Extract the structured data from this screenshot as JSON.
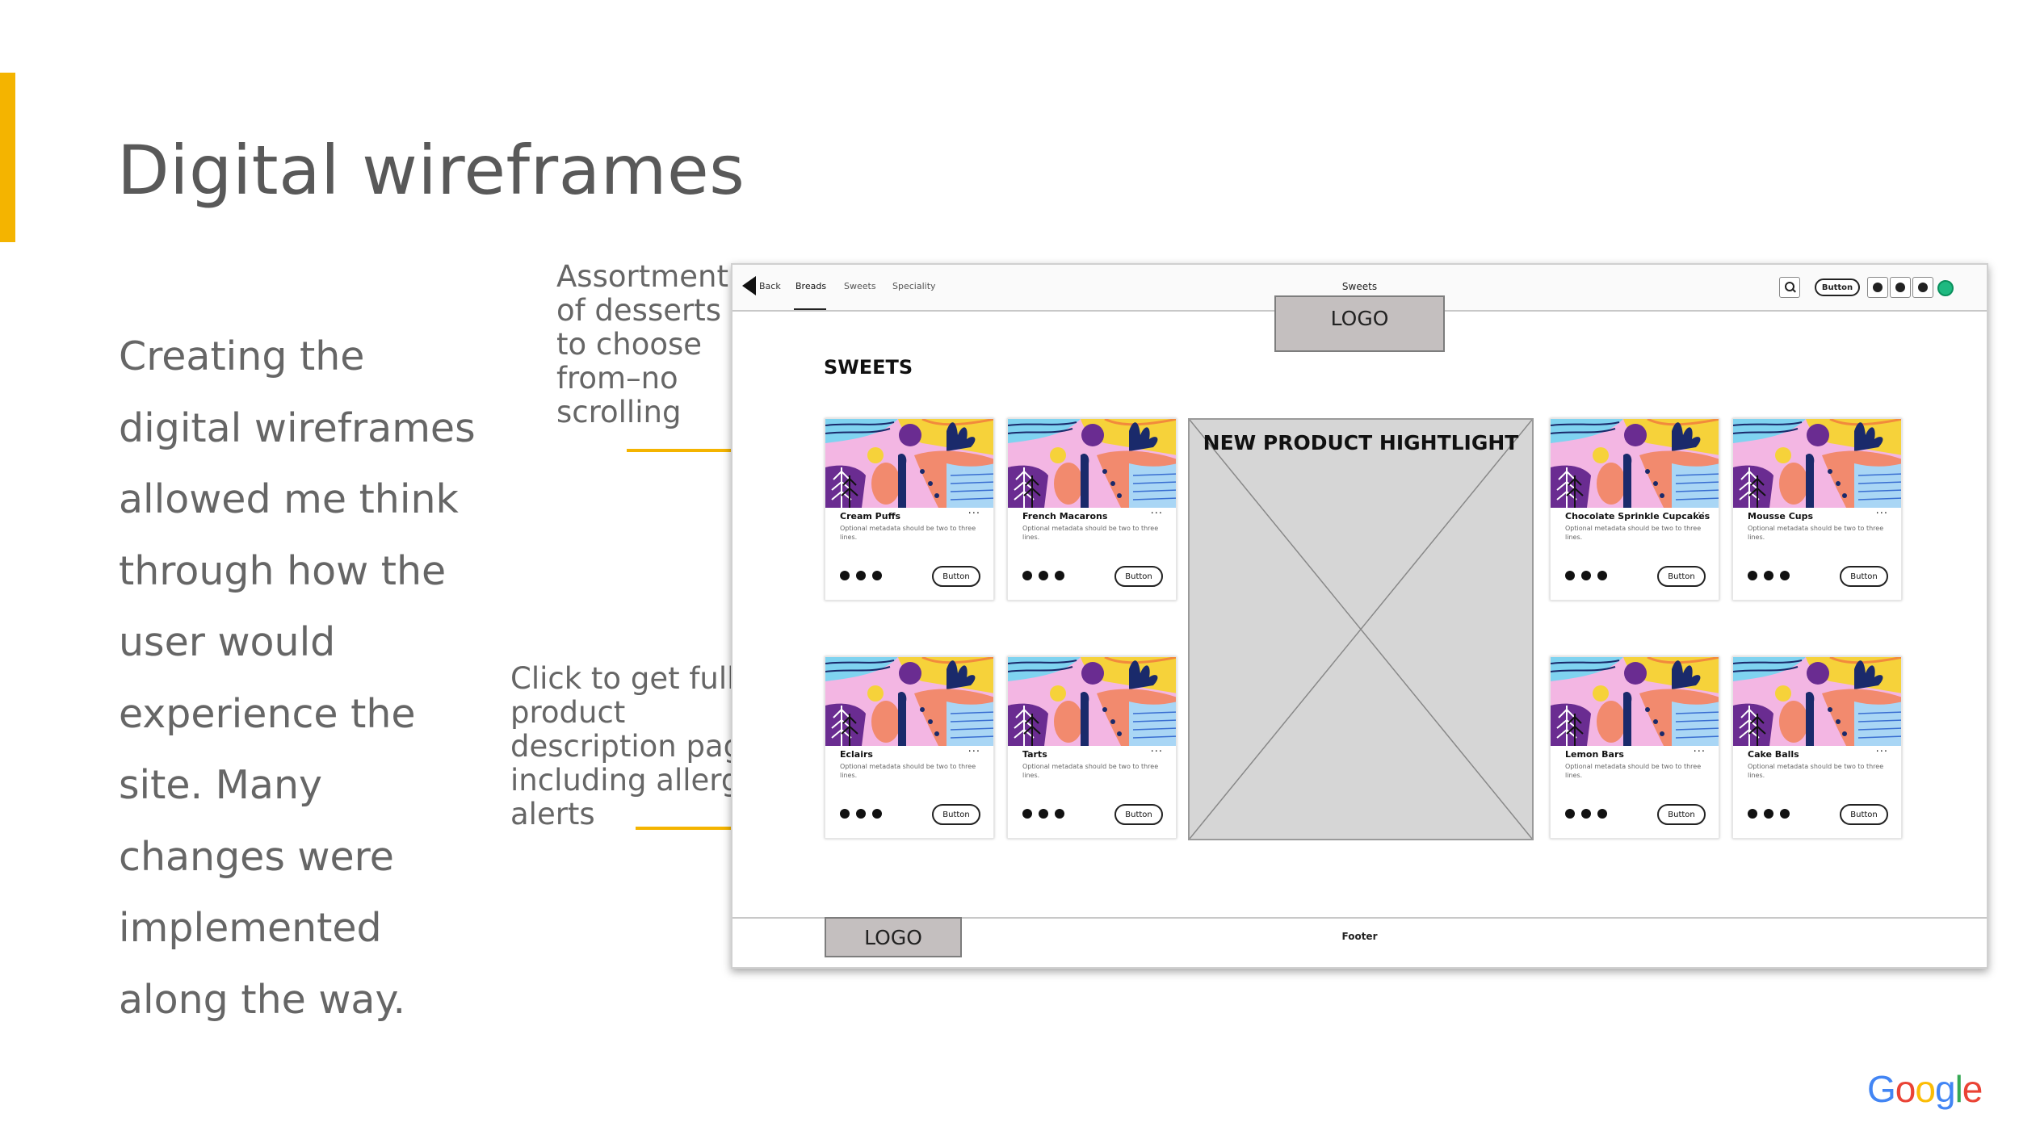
{
  "slide": {
    "title": "Digital wireframes",
    "body": "Creating the digital wireframes allowed me think through how the user would experience the site. Many changes were implemented along the way.",
    "note_1": "Assortment of desserts to choose from–no scrolling",
    "note_2": "Click to get full product description page including allergen alerts",
    "accent_color": "#f4b400",
    "brand_logo": "Google"
  },
  "wireframe": {
    "nav": {
      "back_label": "Back",
      "tabs": [
        "Breads",
        "Sweets",
        "Speciality"
      ],
      "active_tab": "Breads",
      "center_title": "Sweets",
      "button_label": "Button"
    },
    "logo_label": "LOGO",
    "section_heading": "SWEETS",
    "highlight_title": "NEW PRODUCT HIGHTLIGHT",
    "footer_logo": "LOGO",
    "footer_label": "Footer",
    "products": [
      {
        "name": "Cream Puffs",
        "meta": "Optional metadata should be two to three lines.",
        "button": "Button"
      },
      {
        "name": "French Macarons",
        "meta": "Optional metadata should be two to three lines.",
        "button": "Button"
      },
      {
        "name": "Chocolate Sprinkle Cupcakes",
        "meta": "Optional metadata should be two to three lines.",
        "button": "Button"
      },
      {
        "name": "Mousse Cups",
        "meta": "Optional metadata should be two to three lines.",
        "button": "Button"
      },
      {
        "name": "Eclairs",
        "meta": "Optional metadata should be two to three lines.",
        "button": "Button"
      },
      {
        "name": "Tarts",
        "meta": "Optional metadata should be two to three lines.",
        "button": "Button"
      },
      {
        "name": "Lemon Bars",
        "meta": "Optional metadata should be two to three lines.",
        "button": "Button"
      },
      {
        "name": "Cake Balls",
        "meta": "Optional metadata should be two to three lines.",
        "button": "Button"
      }
    ],
    "more_glyph": "···"
  }
}
